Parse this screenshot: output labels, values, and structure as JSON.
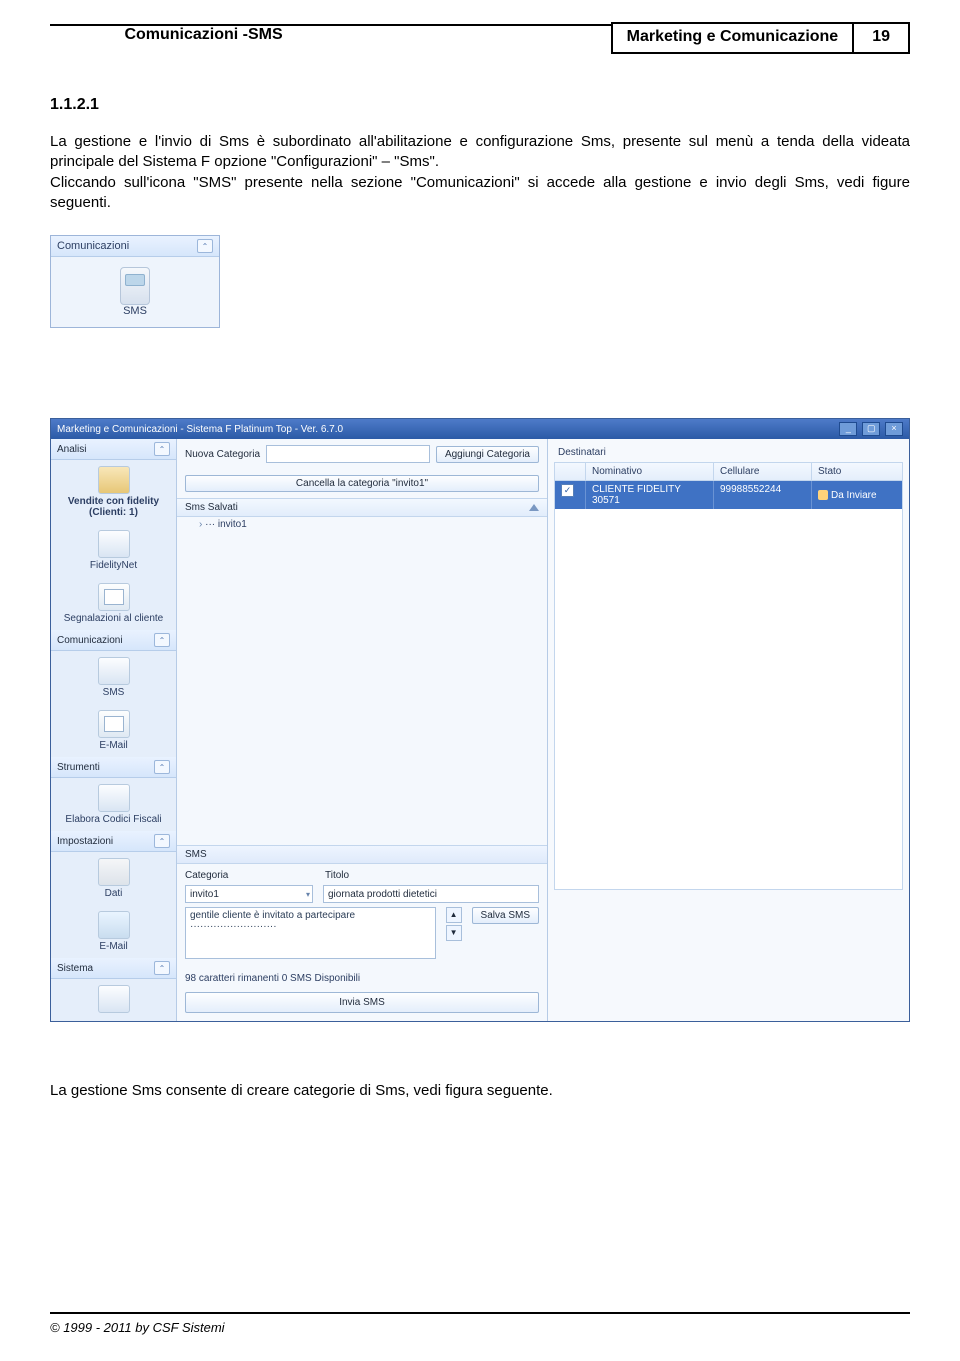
{
  "header": {
    "title": "Marketing e Comunicazione",
    "page_num": "19"
  },
  "section": {
    "num": "1.1.2.1",
    "title": "Comunicazioni -SMS"
  },
  "p1": "La gestione e l'invio di Sms è subordinato all'abilitazione e configurazione Sms, presente sul menù a tenda della videata principale del Sistema F opzione \"Configurazioni\" – \"Sms\".",
  "p2": "Cliccando sull'icona \"SMS\" presente nella sezione \"Comunicazioni\" si accede alla gestione e invio degli Sms, vedi figure seguenti.",
  "panel_small": {
    "title": "Comunicazioni",
    "item_label": "SMS"
  },
  "app": {
    "title": "Marketing e Comunicazioni - Sistema F Platinum Top - Ver. 6.7.0",
    "sidebar": {
      "groups": {
        "analisi": {
          "title": "Analisi",
          "items": [
            "Vendite con fidelity (Clienti: 1)",
            "FidelityNet",
            "Segnalazioni al cliente"
          ]
        },
        "comunicazioni": {
          "title": "Comunicazioni",
          "items": [
            "SMS",
            "E-Mail"
          ]
        },
        "strumenti": {
          "title": "Strumenti",
          "items": [
            "Elabora Codici Fiscali"
          ]
        },
        "impostazioni": {
          "title": "Impostazioni",
          "items": [
            "Dati",
            "E-Mail"
          ]
        },
        "sistema": {
          "title": "Sistema"
        }
      }
    },
    "mid": {
      "nuova_label": "Nuova Categoria",
      "aggiungi_btn": "Aggiungi Categoria",
      "cancella_btn": "Cancella la categoria \"invito1\"",
      "list_header": "Sms Salvati",
      "list_item": "··· invito1",
      "sms_section": "SMS",
      "cat_label": "Categoria",
      "tit_label": "Titolo",
      "cat_value": "invito1",
      "tit_value": "giornata prodotti dietetici",
      "body_value": "gentile cliente è invitato a partecipare\n··························",
      "salva_btn": "Salva SMS",
      "status": "98 caratteri rimanenti 0 SMS Disponibili",
      "send_btn": "Invia SMS"
    },
    "right": {
      "title": "Destinatari",
      "cols": {
        "nom": "Nominativo",
        "cel": "Cellulare",
        "stato": "Stato"
      },
      "row": {
        "nom": "CLIENTE FIDELITY 30571",
        "cel": "99988552244",
        "stato": "Da Inviare"
      }
    }
  },
  "p3": "La gestione Sms consente di creare categorie di Sms, vedi figura seguente.",
  "footer": "© 1999 - 2011 by CSF Sistemi"
}
